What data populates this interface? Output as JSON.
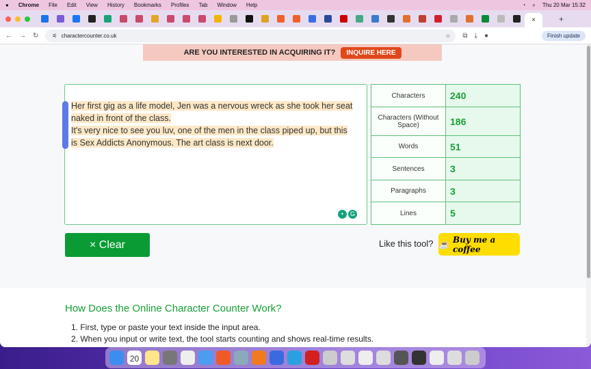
{
  "menubar": {
    "app": "Chrome",
    "items": [
      "File",
      "Edit",
      "View",
      "History",
      "Bookmarks",
      "Profiles",
      "Tab",
      "Window",
      "Help"
    ],
    "clock": "Thu 20 Mar  15:32"
  },
  "tabs": {
    "favicon_colors": [
      "#1a73e8",
      "#7b5cd6",
      "#1877f2",
      "#222",
      "#1aa37a",
      "#c94a6a",
      "#c94a6a",
      "#e5a522",
      "#c94a6a",
      "#c94a6a",
      "#c94a6a",
      "#f2b400",
      "#999",
      "#111",
      "#e0a020",
      "#f0602a",
      "#f0602a",
      "#3b6ee0",
      "#2a4a9a",
      "#c00",
      "#4a8",
      "#3a7ad0",
      "#333",
      "#e07030",
      "#c04030",
      "#d02030",
      "#aaa",
      "#e07030",
      "#0a8a3a",
      "#bbb",
      "#222"
    ],
    "active_close": "×",
    "new_tab": "+"
  },
  "address": {
    "url": "charactercounter.co.uk",
    "finish_update": "Finish update"
  },
  "banner": {
    "text": "ARE YOU INTERESTED IN ACQUIRING IT?",
    "button": "INQUIRE HERE"
  },
  "textarea": {
    "lines": [
      "Her first gig as a life model, Jen was a nervous wreck as she took her seat",
      "naked in front of the class.",
      "It's very nice to see you luv, one of the men in the class piped up, but this",
      "is Sex Addicts Anonymous. The art class is next door."
    ]
  },
  "stats": [
    {
      "label": "Characters",
      "value": "240"
    },
    {
      "label": "Characters (Without Space)",
      "value": "186"
    },
    {
      "label": "Words",
      "value": "51"
    },
    {
      "label": "Sentences",
      "value": "3"
    },
    {
      "label": "Paragraphs",
      "value": "3"
    },
    {
      "label": "Lines",
      "value": "5"
    }
  ],
  "clear_label": "× Clear",
  "like_text": "Like this tool?",
  "coffee_label": "Buy me a coffee",
  "section": {
    "heading": "How Does the Online Character Counter Work?",
    "steps": [
      "1. First, type or paste your text inside the input area.",
      "2. When you input or write text, the tool starts counting and shows real-time results."
    ]
  },
  "dock": {
    "calendar_day": "20"
  }
}
